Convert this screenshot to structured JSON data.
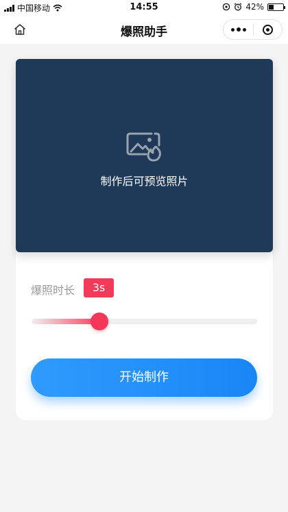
{
  "status_bar": {
    "carrier": "中国移动",
    "time": "14:55",
    "battery_percent": "42%",
    "battery_level": 0.42
  },
  "nav": {
    "title": "爆照助手"
  },
  "preview": {
    "placeholder_text": "制作后可预览照片",
    "icon": "image-fire-icon"
  },
  "settings": {
    "duration_label": "爆照时长",
    "duration_value": "3s",
    "slider_fraction": 0.3
  },
  "actions": {
    "start_label": "开始制作"
  },
  "colors": {
    "preview_bg": "#1f3a58",
    "accent_red": "#f23b5a",
    "button_blue": "#2090fa"
  }
}
